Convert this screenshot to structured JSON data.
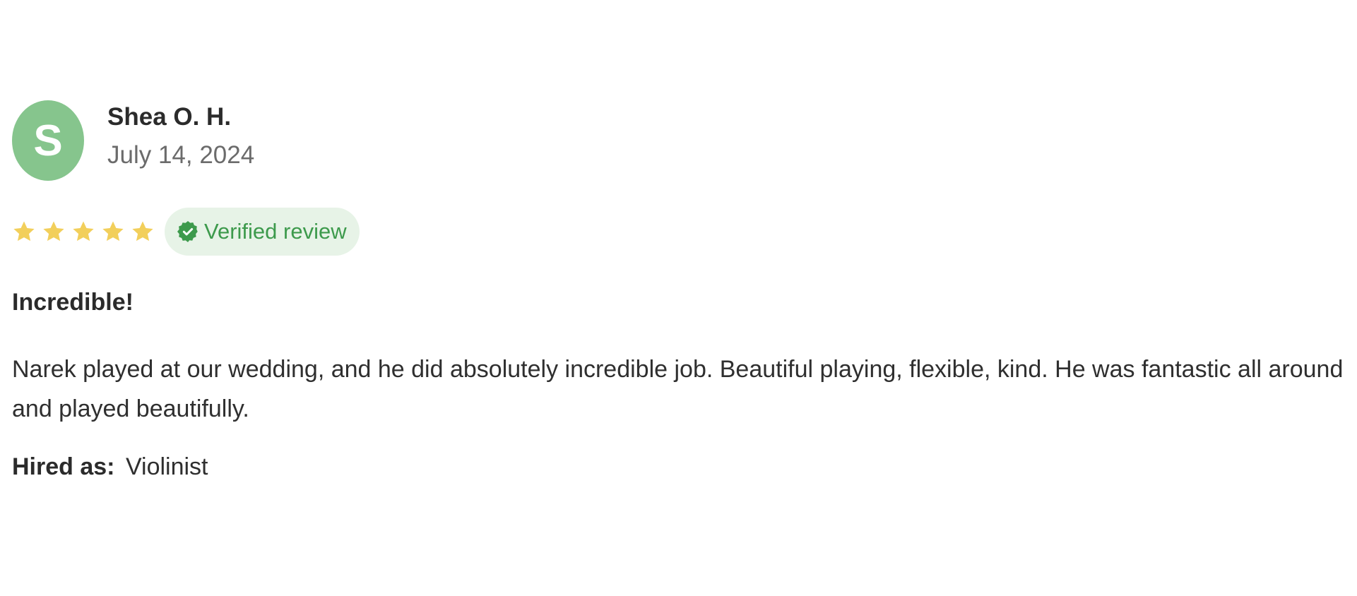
{
  "reviewer": {
    "initial": "S",
    "name": "Shea O. H.",
    "date": "July 14, 2024",
    "avatar_color": "#86c58d"
  },
  "rating": {
    "stars": 5,
    "max": 5,
    "star_color": "#f2cf5b",
    "star_icon": "star-icon"
  },
  "badge": {
    "label": "Verified review",
    "icon": "verified-check-icon",
    "text_color": "#3d9a4c",
    "background": "#e7f3e7"
  },
  "review": {
    "title": "Incredible!",
    "body": "Narek played at our wedding, and he did absolutely incredible job. Beautiful playing, flexible, kind. He was fantastic all around and played beautifully."
  },
  "hired": {
    "label": "Hired as:",
    "value": "Violinist"
  }
}
